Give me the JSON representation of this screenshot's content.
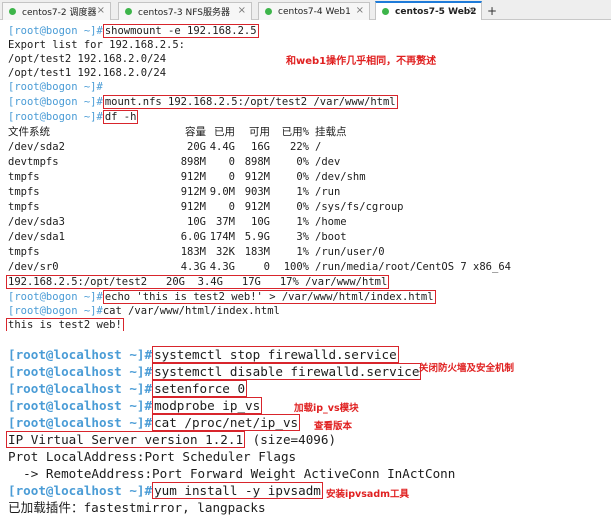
{
  "tabs": [
    {
      "label": "centos7-2 调度器",
      "dot": "#3db54a",
      "active": false
    },
    {
      "label": "centos7-3 NFS服务器",
      "dot": "#3db54a",
      "active": false
    },
    {
      "label": "centos7-4 Web1",
      "dot": "#3db54a",
      "active": false
    },
    {
      "label": "centos7-5 Web2",
      "dot": "#3db54a",
      "active": true
    }
  ],
  "tab_add": "+",
  "tab_close": "×",
  "term1": {
    "prompt": "[root@bogon ~]#",
    "showmount_cmd": "showmount -e 192.168.2.5",
    "export_header": "Export list for 192.168.2.5:",
    "export_1": "/opt/test2 192.168.2.0/24",
    "export_2": "/opt/test1 192.168.2.0/24",
    "note_same": "和web1操作几乎相同，不再赘述",
    "mount_cmd": "mount.nfs 192.168.2.5:/opt/test2 /var/www/html",
    "df_cmd": "df -h",
    "df_header": [
      "文件系统",
      "容量",
      "已用",
      "可用",
      "已用%",
      "挂载点"
    ],
    "df_rows": [
      [
        "/dev/sda2",
        "20G",
        "4.4G",
        "16G",
        "22%",
        "/"
      ],
      [
        "devtmpfs",
        "898M",
        "0",
        "898M",
        "0%",
        "/dev"
      ],
      [
        "tmpfs",
        "912M",
        "0",
        "912M",
        "0%",
        "/dev/shm"
      ],
      [
        "tmpfs",
        "912M",
        "9.0M",
        "903M",
        "1%",
        "/run"
      ],
      [
        "tmpfs",
        "912M",
        "0",
        "912M",
        "0%",
        "/sys/fs/cgroup"
      ],
      [
        "/dev/sda3",
        "10G",
        "37M",
        "10G",
        "1%",
        "/home"
      ],
      [
        "/dev/sda1",
        "6.0G",
        "174M",
        "5.9G",
        "3%",
        "/boot"
      ],
      [
        "tmpfs",
        "183M",
        "32K",
        "183M",
        "1%",
        "/run/user/0"
      ],
      [
        "/dev/sr0",
        "4.3G",
        "4.3G",
        "0",
        "100%",
        "/run/media/root/CentOS 7 x86_64"
      ]
    ],
    "nfs_row": "192.168.2.5:/opt/test2   20G  3.4G   17G   17% /var/www/html",
    "echo_cmd": "echo 'this is test2 web!' > /var/www/html/index.html",
    "cat_cmd": "cat /var/www/html/index.html",
    "cat_output": "this is test2 web!"
  },
  "term2": {
    "prompt": "[root@localhost ~]#",
    "cmd_stop": "systemctl stop firewalld.service",
    "cmd_disable": "systemctl disable firewalld.service",
    "cmd_setenforce": "setenforce 0",
    "note_firewall": "关闭防火墙及安全机制",
    "cmd_modprobe": "modprobe ip_vs",
    "note_modprobe": "加载ip_vs模块",
    "cmd_cat": "cat /proc/net/ip_vs",
    "note_version": "查看版本",
    "ipvs_version": "IP Virtual Server version 1.2.1",
    "ipvs_size": " (size=4096)",
    "ipvs_line2": "Prot LocalAddress:Port Scheduler Flags",
    "ipvs_line3": "  -> RemoteAddress:Port Forward Weight ActiveConn InActConn",
    "cmd_yum": "yum install -y ipvsadm",
    "note_yum": "安装ipvsadm工具",
    "plugins_line": "已加载插件：fastestmirror, langpacks"
  }
}
